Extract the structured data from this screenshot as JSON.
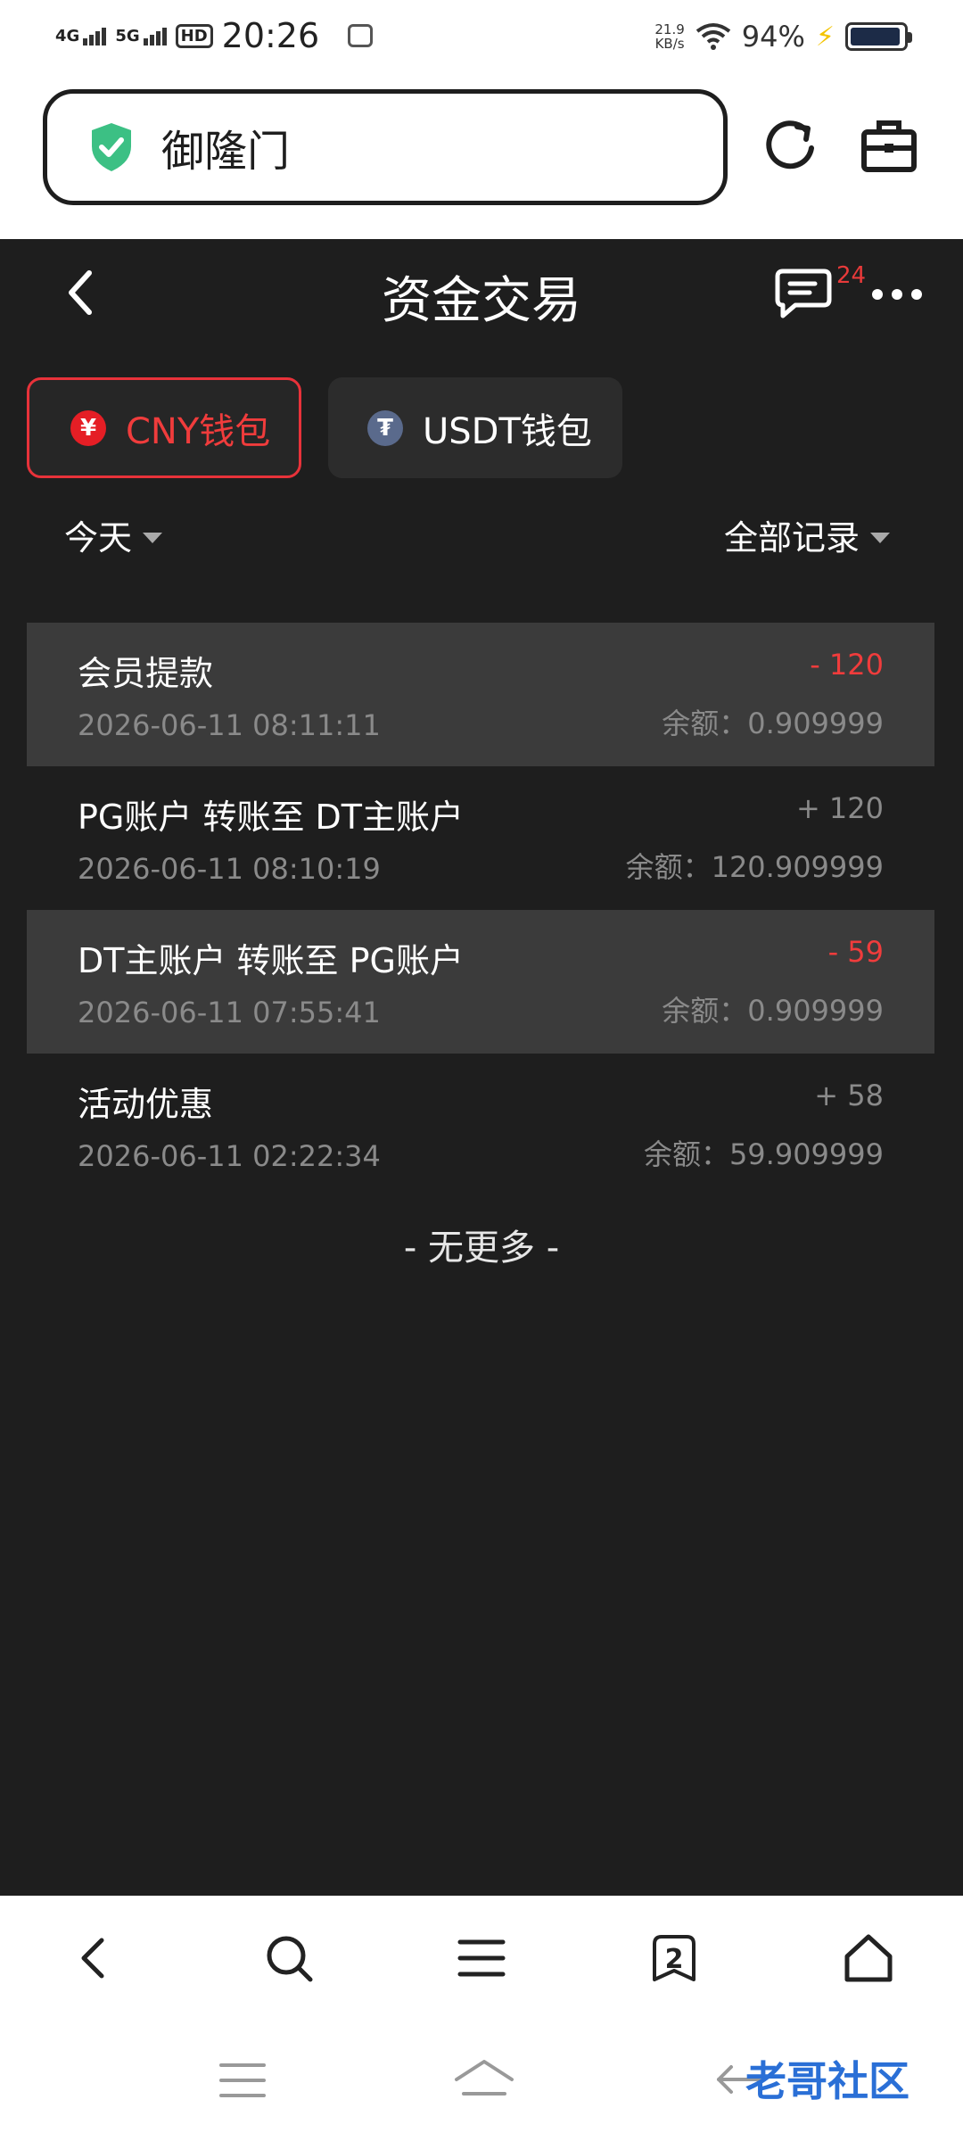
{
  "status_bar": {
    "network1": "4G",
    "network2": "5G",
    "hd_label": "HD",
    "time": "20:26",
    "net_speed_value": "21.9",
    "net_speed_unit": "KB/s",
    "battery_percent": "94%",
    "battery_level": 0.94
  },
  "browser": {
    "url_text": "御隆门",
    "tab_count": "2"
  },
  "header": {
    "title": "资金交易",
    "message_badge": "24"
  },
  "wallet_tabs": [
    {
      "label": "CNY钱包",
      "icon_glyph": "¥",
      "active": true
    },
    {
      "label": "USDT钱包",
      "icon_glyph": "₮",
      "active": false
    }
  ],
  "filters": {
    "date": "今天",
    "type": "全部记录"
  },
  "records": [
    {
      "title": "会员提款",
      "time": "2026-06-11 08:11:11",
      "amount": "- 120",
      "balance": "余额：0.909999",
      "direction": "out"
    },
    {
      "title": "PG账户 转账至 DT主账户",
      "time": "2026-06-11 08:10:19",
      "amount": "+ 120",
      "balance": "余额：120.909999",
      "direction": "in"
    },
    {
      "title": "DT主账户 转账至 PG账户",
      "time": "2026-06-11 07:55:41",
      "amount": "- 59",
      "balance": "余额：0.909999",
      "direction": "out"
    },
    {
      "title": "活动优惠",
      "time": "2026-06-11 02:22:34",
      "amount": "+ 58",
      "balance": "余额：59.909999",
      "direction": "in"
    }
  ],
  "no_more_text": "- 无更多 -",
  "watermark_text": "老哥社区",
  "colors": {
    "accent_red": "#f03c3c",
    "shield_green": "#3cc084",
    "background": "#1e1e1e"
  }
}
